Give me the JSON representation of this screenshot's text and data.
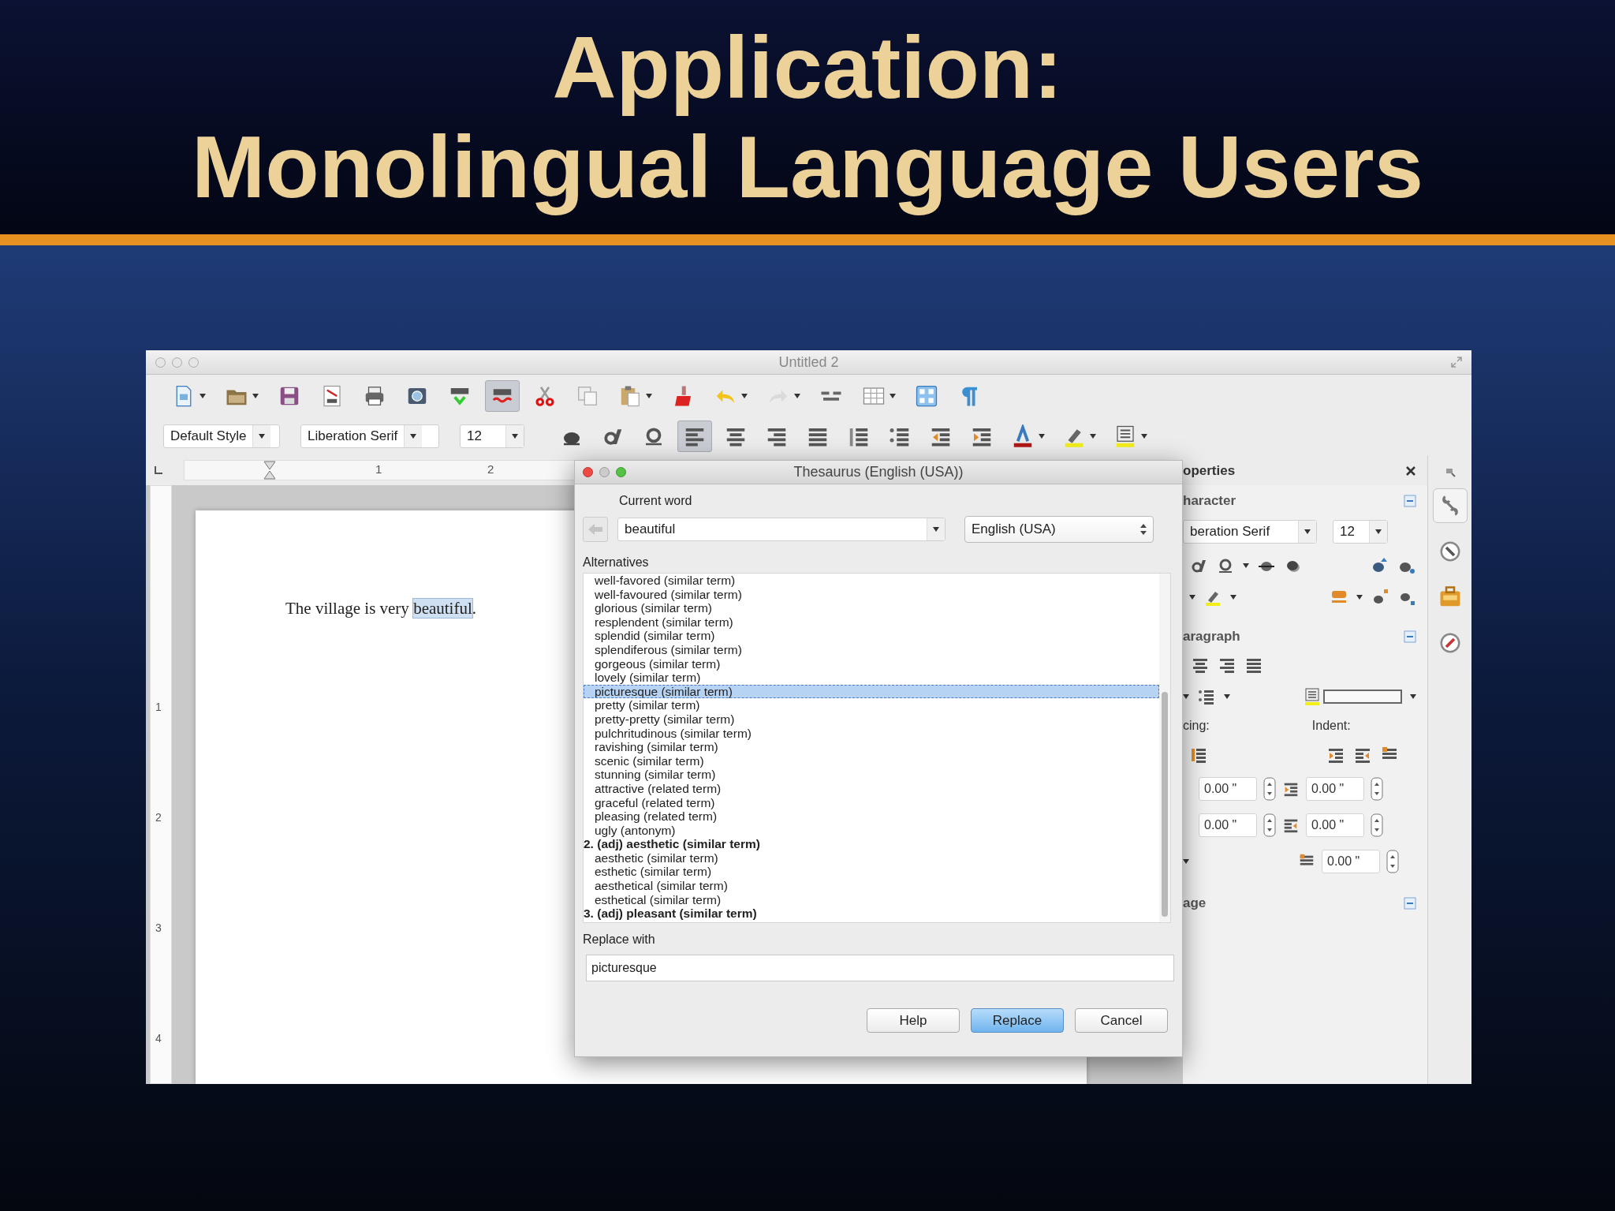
{
  "slide": {
    "title_lines": [
      "Application:",
      "Monolingual Language Users"
    ]
  },
  "window": {
    "title": "Untitled 2"
  },
  "toolbar_1": [
    {
      "kind": "new",
      "caret": true,
      "on": false,
      "disabled": false
    },
    {
      "kind": "open",
      "caret": true,
      "on": false,
      "disabled": false
    },
    {
      "kind": "save",
      "caret": false,
      "on": false,
      "disabled": false
    },
    {
      "kind": "pdf",
      "caret": false,
      "on": false,
      "disabled": false
    },
    {
      "kind": "print",
      "caret": false,
      "on": false,
      "disabled": false
    },
    {
      "kind": "preview",
      "caret": false,
      "on": false,
      "disabled": false
    },
    {
      "kind": "spellcheck",
      "caret": false,
      "on": false,
      "disabled": false
    },
    {
      "kind": "autospell",
      "caret": false,
      "on": true,
      "disabled": false
    },
    {
      "kind": "cut",
      "caret": false,
      "on": false,
      "disabled": false
    },
    {
      "kind": "copy",
      "caret": false,
      "on": false,
      "disabled": false
    },
    {
      "kind": "paste",
      "caret": true,
      "on": false,
      "disabled": false
    },
    {
      "kind": "clone",
      "caret": false,
      "on": false,
      "disabled": false
    },
    {
      "kind": "undo",
      "caret": true,
      "on": false,
      "disabled": false
    },
    {
      "kind": "redo",
      "caret": true,
      "on": false,
      "disabled": true
    },
    {
      "kind": "find",
      "caret": false,
      "on": false,
      "disabled": false
    },
    {
      "kind": "table",
      "caret": true,
      "on": false,
      "disabled": false
    },
    {
      "kind": "grid",
      "caret": false,
      "on": false,
      "disabled": false
    },
    {
      "kind": "pilcrow",
      "caret": false,
      "on": false,
      "disabled": false
    }
  ],
  "toolbar_2": {
    "paragraph_style": "Default Style",
    "font_name": "Liberation Serif",
    "font_size": "12",
    "buttons": [
      {
        "kind": "bold",
        "caret": false,
        "on": false
      },
      {
        "kind": "italic",
        "caret": false,
        "on": false
      },
      {
        "kind": "underline",
        "caret": false,
        "on": false
      },
      {
        "kind": "align-left",
        "caret": false,
        "on": true
      },
      {
        "kind": "center",
        "caret": false,
        "on": false
      },
      {
        "kind": "right",
        "caret": false,
        "on": false
      },
      {
        "kind": "justify",
        "caret": false,
        "on": false
      },
      {
        "kind": "numbered",
        "caret": false,
        "on": false
      },
      {
        "kind": "bullets",
        "caret": false,
        "on": false
      },
      {
        "kind": "outdent",
        "caret": false,
        "on": false
      },
      {
        "kind": "indent",
        "caret": false,
        "on": false
      },
      {
        "kind": "font-color",
        "caret": true,
        "on": false
      },
      {
        "kind": "highlight",
        "caret": true,
        "on": false
      },
      {
        "kind": "para-bg",
        "caret": true,
        "on": false
      }
    ]
  },
  "ruler": {
    "horizontal_labels": [
      "1",
      "2"
    ],
    "vertical_labels": [
      "1",
      "2",
      "3",
      "4"
    ]
  },
  "document": {
    "before": "The village is very ",
    "selection": "beautiful",
    "after": "."
  },
  "dialog": {
    "title": "Thesaurus (English (USA))",
    "current_word_label": "Current word",
    "current_word": "beautiful",
    "language": "English (USA)",
    "alternatives_label": "Alternatives",
    "alternatives": [
      {
        "text": "well-favored (similar term)",
        "kind": "term",
        "selected": false
      },
      {
        "text": "well-favoured (similar term)",
        "kind": "term",
        "selected": false
      },
      {
        "text": "glorious (similar term)",
        "kind": "term",
        "selected": false
      },
      {
        "text": "resplendent (similar term)",
        "kind": "term",
        "selected": false
      },
      {
        "text": "splendid (similar term)",
        "kind": "term",
        "selected": false
      },
      {
        "text": "splendiferous (similar term)",
        "kind": "term",
        "selected": false
      },
      {
        "text": "gorgeous (similar term)",
        "kind": "term",
        "selected": false
      },
      {
        "text": "lovely (similar term)",
        "kind": "term",
        "selected": false
      },
      {
        "text": "picturesque (similar term)",
        "kind": "term",
        "selected": true
      },
      {
        "text": "pretty (similar term)",
        "kind": "term",
        "selected": false
      },
      {
        "text": "pretty-pretty (similar term)",
        "kind": "term",
        "selected": false
      },
      {
        "text": "pulchritudinous (similar term)",
        "kind": "term",
        "selected": false
      },
      {
        "text": "ravishing (similar term)",
        "kind": "term",
        "selected": false
      },
      {
        "text": "scenic (similar term)",
        "kind": "term",
        "selected": false
      },
      {
        "text": "stunning (similar term)",
        "kind": "term",
        "selected": false
      },
      {
        "text": "attractive (related term)",
        "kind": "term",
        "selected": false
      },
      {
        "text": "graceful (related term)",
        "kind": "term",
        "selected": false
      },
      {
        "text": "pleasing (related term)",
        "kind": "term",
        "selected": false
      },
      {
        "text": "ugly (antonym)",
        "kind": "term",
        "selected": false
      },
      {
        "text": "2. (adj) aesthetic (similar term)",
        "kind": "heading",
        "selected": false
      },
      {
        "text": "aesthetic (similar term)",
        "kind": "term",
        "selected": false
      },
      {
        "text": "esthetic (similar term)",
        "kind": "term",
        "selected": false
      },
      {
        "text": "aesthetical (similar term)",
        "kind": "term",
        "selected": false
      },
      {
        "text": "esthetical (similar term)",
        "kind": "term",
        "selected": false
      },
      {
        "text": "3. (adj) pleasant (similar term)",
        "kind": "heading",
        "selected": false
      }
    ],
    "replace_label": "Replace with",
    "replace_value": "picturesque",
    "buttons": [
      {
        "label": "Help",
        "default": false
      },
      {
        "label": "Replace",
        "default": true
      },
      {
        "label": "Cancel",
        "default": false
      }
    ]
  },
  "sidebar": {
    "title": "operties",
    "character_title": "haracter",
    "font_name": "beration Serif",
    "font_size": "12",
    "paragraph_title": "aragraph",
    "spacing_label": "cing:",
    "indent_label": "Indent:",
    "spacing_values": [
      "0.00 \"",
      "0.00 \""
    ],
    "indent_values": [
      "0.00 \"",
      "0.00 \"",
      "0.00 \""
    ],
    "page_title": "age",
    "tabs": [
      {
        "kind": "properties",
        "selected": true
      },
      {
        "kind": "styles",
        "selected": false
      },
      {
        "kind": "gallery",
        "selected": false
      },
      {
        "kind": "navigator",
        "selected": false
      }
    ]
  }
}
